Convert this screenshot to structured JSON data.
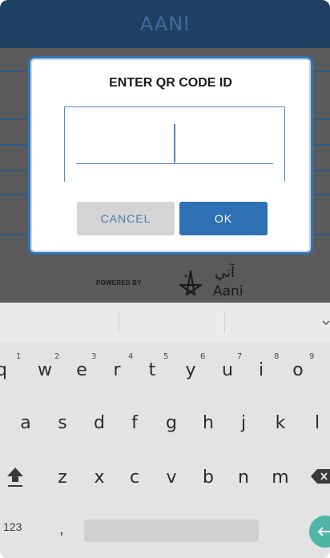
{
  "app": {
    "title": "AANI"
  },
  "dialog": {
    "title": "ENTER QR CODE ID",
    "input_value": "",
    "cancel_label": "CANCEL",
    "ok_label": "OK"
  },
  "branding": {
    "powered_by": "POWERED BY",
    "logo_arabic": "آني",
    "logo_english": "Aani",
    "logo_icon": "aani-star-icon"
  },
  "keyboard": {
    "row1": [
      "q",
      "w",
      "e",
      "r",
      "t",
      "y",
      "u",
      "i",
      "o"
    ],
    "row1_hints": [
      "1",
      "2",
      "3",
      "4",
      "5",
      "6",
      "7",
      "8",
      "9"
    ],
    "row2": [
      "a",
      "s",
      "d",
      "f",
      "g",
      "h",
      "j",
      "k",
      "l"
    ],
    "row3": [
      "z",
      "x",
      "c",
      "v",
      "b",
      "n",
      "m"
    ],
    "symbols_label": "123",
    "comma_label": ",",
    "icons": [
      "shift-icon",
      "backspace-icon",
      "enter-icon",
      "chevron-down-icon"
    ]
  },
  "colors": {
    "accent": "#2f6fb4",
    "header_bg": "#1f3f63",
    "enter_key": "#50b5a4"
  }
}
